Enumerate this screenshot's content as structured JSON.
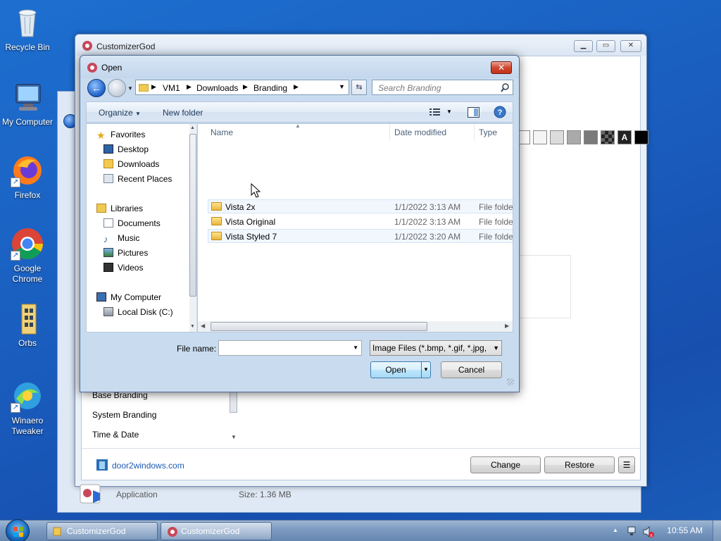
{
  "desktop": {
    "icons": [
      {
        "label": "Recycle Bin"
      },
      {
        "label": "My Computer"
      },
      {
        "label": "Firefox"
      },
      {
        "label": "Google Chrome"
      },
      {
        "label": "Orbs"
      },
      {
        "label": "Winaero Tweaker"
      }
    ]
  },
  "customizer": {
    "title": "CustomizerGod",
    "list_items": [
      "Base Branding",
      "System Branding",
      "Time & Date"
    ],
    "link": "door2windows.com",
    "change_label": "Change",
    "restore_label": "Restore",
    "menu_label": "☰",
    "status_type": "Application",
    "status_size": "Size: 1.36 MB",
    "swatch_letter": "A"
  },
  "dialog": {
    "title": "Open",
    "close_label": "✕",
    "breadcrumb": [
      "VM1",
      "Downloads",
      "Branding"
    ],
    "search_placeholder": "Search Branding",
    "organize_label": "Organize",
    "new_folder_label": "New folder",
    "nav": {
      "favorites": "Favorites",
      "desktop": "Desktop",
      "downloads": "Downloads",
      "recent": "Recent Places",
      "libraries": "Libraries",
      "documents": "Documents",
      "music": "Music",
      "pictures": "Pictures",
      "videos": "Videos",
      "computer": "My Computer",
      "localdisk": "Local Disk (C:)"
    },
    "columns": {
      "name": "Name",
      "date": "Date modified",
      "type": "Type"
    },
    "files": [
      {
        "name": "Vista 2x",
        "date": "1/1/2022 3:13 AM",
        "type": "File folder"
      },
      {
        "name": "Vista Original",
        "date": "1/1/2022 3:13 AM",
        "type": "File folder"
      },
      {
        "name": "Vista Styled 7",
        "date": "1/1/2022 3:20 AM",
        "type": "File folder"
      }
    ],
    "filename_label": "File name:",
    "filename_value": "",
    "filetype_value": "Image Files (*.bmp, *.gif, *.jpg,",
    "open_label": "Open",
    "cancel_label": "Cancel"
  },
  "taskbar": {
    "items": [
      "CustomizerGod",
      "CustomizerGod"
    ],
    "clock": "10:55 AM"
  },
  "colors": {
    "accent": "#1c5fc9",
    "link": "#1e5bb4",
    "close_red": "#c2321a"
  }
}
